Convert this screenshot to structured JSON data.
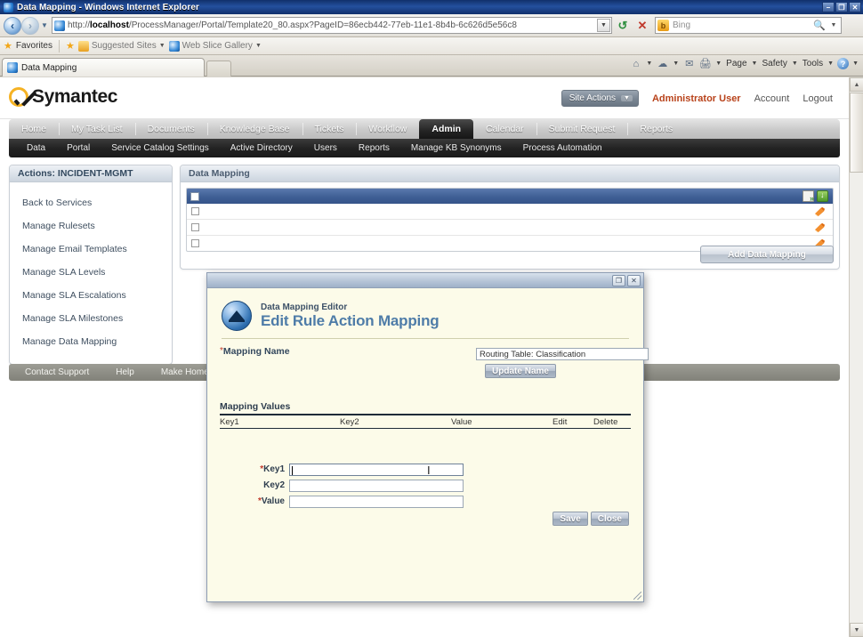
{
  "browser": {
    "window_title": "Data Mapping - Windows Internet Explorer",
    "url": "http://localhost/ProcessManager/Portal/Template20_80.aspx?PageID=86ecb442-77eb-11e1-8b4b-6c626d5e56c8",
    "url_host": "localhost",
    "url_rest": "/ProcessManager/Portal/Template20_80.aspx?PageID=86ecb442-77eb-11e1-8b4b-6c626d5e56c8",
    "url_scheme": "http://",
    "search_placeholder": "Bing",
    "search_value": "",
    "tab_title": "Data Mapping",
    "favorites_label": "Favorites",
    "favbar": [
      {
        "label": "Suggested Sites"
      },
      {
        "label": "Web Slice Gallery"
      }
    ],
    "commandbar": [
      {
        "label": "Page"
      },
      {
        "label": "Safety"
      },
      {
        "label": "Tools"
      }
    ],
    "window_buttons": {
      "minimize": "–",
      "maximize": "❐",
      "close": "✕"
    }
  },
  "portal": {
    "brand": "Symantec",
    "site_actions": "Site Actions",
    "user": "Administrator User",
    "account": "Account",
    "logout": "Logout",
    "mainnav": [
      {
        "label": "Home",
        "active": false
      },
      {
        "label": "My Task List",
        "active": false
      },
      {
        "label": "Documents",
        "active": false
      },
      {
        "label": "Knowledge Base",
        "active": false
      },
      {
        "label": "Tickets",
        "active": false
      },
      {
        "label": "Workflow",
        "active": false
      },
      {
        "label": "Admin",
        "active": true
      },
      {
        "label": "Calendar",
        "active": false
      },
      {
        "label": "Submit Request",
        "active": false
      },
      {
        "label": "Reports",
        "active": false
      }
    ],
    "subnav": [
      {
        "label": "Data"
      },
      {
        "label": "Portal"
      },
      {
        "label": "Service Catalog Settings"
      },
      {
        "label": "Active Directory"
      },
      {
        "label": "Users"
      },
      {
        "label": "Reports"
      },
      {
        "label": "Manage KB Synonyms"
      },
      {
        "label": "Process Automation"
      }
    ],
    "footer": [
      {
        "label": "Contact Support"
      },
      {
        "label": "Help"
      },
      {
        "label": "Make Home Page"
      }
    ]
  },
  "sidebar": {
    "title": "Actions: INCIDENT-MGMT",
    "items": [
      {
        "label": "Back to Services"
      },
      {
        "label": "Manage Rulesets"
      },
      {
        "label": "Manage Email Templates"
      },
      {
        "label": "Manage SLA Levels"
      },
      {
        "label": "Manage SLA Escalations"
      },
      {
        "label": "Manage SLA Milestones"
      },
      {
        "label": "Manage Data Mapping"
      }
    ]
  },
  "data_mapping_panel": {
    "title": "Data Mapping",
    "add_button": "Add Data Mapping",
    "rows": [
      {
        "selected": false
      },
      {
        "selected": false
      },
      {
        "selected": false
      }
    ],
    "icons": {
      "export": "export-icon",
      "import": "import-icon",
      "row_edit": "edit-pencil-icon",
      "select_all": "select-all-checkbox"
    }
  },
  "modal": {
    "window_buttons": {
      "maximize": "❐",
      "close": "✕"
    },
    "eyebrow": "Data Mapping Editor",
    "title": "Edit Rule Action Mapping",
    "mapping_name_label": "Mapping Name",
    "mapping_name_required": "*",
    "mapping_name_value": "Routing Table: Classification",
    "mapping_name_placeholder": "",
    "update_name_button": "Update Name",
    "mapping_values_title": "Mapping Values",
    "grid_headers": [
      "Key1",
      "Key2",
      "Value",
      "Edit",
      "Delete"
    ],
    "grid_rows": [],
    "fields": [
      {
        "label": "Key1",
        "required": "*",
        "value": "",
        "focused": true
      },
      {
        "label": "Key2",
        "required": "",
        "value": "",
        "focused": false
      },
      {
        "label": "Value",
        "required": "*",
        "value": "",
        "focused": false
      }
    ],
    "save_button": "Save",
    "close_button": "Close"
  },
  "colors": {
    "brand_yellow": "#f5b223",
    "modal_bg": "#fcfbe9",
    "modal_title_blue": "#4e7ca8",
    "accent_user_red": "#b8421a",
    "grid_header_blue": "#3f5f95"
  }
}
